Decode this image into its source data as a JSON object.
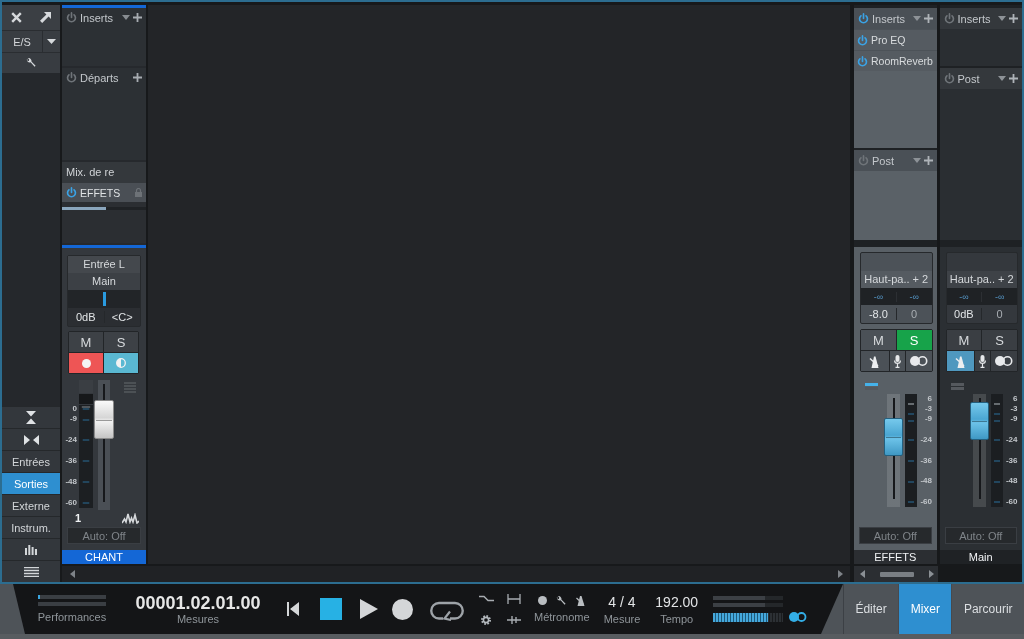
{
  "sidebar": {
    "io_label": "E/S",
    "view_buttons": [
      {
        "label": "Entrées",
        "selected": false
      },
      {
        "label": "Sorties",
        "selected": true
      },
      {
        "label": "Externe",
        "selected": false
      },
      {
        "label": "Instrum.",
        "selected": false
      }
    ]
  },
  "track_channels": [
    {
      "color": "#1467d6",
      "inserts": {
        "label": "Inserts",
        "on": false
      },
      "sends": {
        "label": "Départs",
        "on": false
      },
      "send_group": "Mix. de re",
      "send": {
        "name": "EFFETS",
        "on": true,
        "level": 0.52
      },
      "input": "Entrée L",
      "output": "Main",
      "pan_slider": {
        "level": 0.5
      },
      "volume": "0dB",
      "pan": "<C>",
      "mute": {
        "label": "M",
        "on": false
      },
      "solo": {
        "label": "S",
        "on": false
      },
      "record_armed": true,
      "monitor_on": true,
      "scale": [
        "0",
        "-9",
        "-24",
        "-36",
        "-48",
        "-60"
      ],
      "fader": {
        "level": 0.78
      },
      "number": "1",
      "automation": "Auto: Off",
      "name": "CHANT"
    }
  ],
  "bus_channels": [
    {
      "selected": true,
      "inserts": {
        "label": "Inserts",
        "on": true
      },
      "plugins": [
        {
          "name": "Pro EQ",
          "on": true
        },
        {
          "name": "RoomReverb",
          "on": true
        }
      ],
      "post": {
        "label": "Post",
        "on": false
      },
      "output": "Haut-pa.. + 2",
      "peaks": [
        "-∞",
        "-∞"
      ],
      "volume": "-8.0",
      "pan": "0",
      "mute": {
        "label": "M",
        "on": false
      },
      "solo": {
        "label": "S",
        "on": true
      },
      "tools": [
        {
          "kind": "metronome",
          "on": false
        },
        {
          "kind": "microphone",
          "on": false
        },
        {
          "kind": "toggle",
          "on": false
        }
      ],
      "scale": [
        "6",
        "-3",
        "-9",
        "-24",
        "-36",
        "-48",
        "-60"
      ],
      "fader": {
        "level": 0.68
      },
      "automation": "Auto: Off",
      "name": "EFFETS"
    },
    {
      "selected": false,
      "inserts": {
        "label": "Inserts",
        "on": false
      },
      "post": {
        "label": "Post",
        "on": false
      },
      "output": "Haut-pa.. + 2",
      "peaks": [
        "-∞",
        "-∞"
      ],
      "volume": "0dB",
      "pan": "0",
      "mute": {
        "label": "M",
        "on": false
      },
      "solo": {
        "label": "S",
        "on": false
      },
      "tools": [
        {
          "kind": "metronome",
          "on": true
        },
        {
          "kind": "microphone",
          "on": false
        },
        {
          "kind": "toggle",
          "on": false
        }
      ],
      "scale": [
        "6",
        "-3",
        "-9",
        "-24",
        "-36",
        "-48",
        "-60"
      ],
      "fader": {
        "level": 0.9
      },
      "automation": "Auto: Off",
      "name": "Main"
    }
  ],
  "transport": {
    "performance": {
      "label": "Performances",
      "level": 0.03
    },
    "time": {
      "value": "00001.02.01.00",
      "label": "Mesures"
    },
    "buttons": [
      {
        "kind": "rewind",
        "on": false
      },
      {
        "kind": "stop",
        "on": true
      },
      {
        "kind": "play",
        "on": false
      },
      {
        "kind": "record",
        "on": false
      },
      {
        "kind": "loop",
        "on": false
      }
    ],
    "metronome": {
      "label": "Métronome"
    },
    "signature": {
      "value": "4 / 4",
      "label": "Mesure"
    },
    "tempo": {
      "value": "192.00",
      "label": "Tempo"
    },
    "output_meter": {
      "level": 0.78
    },
    "sync_toggle": {
      "on": true
    }
  },
  "views": [
    {
      "label": "Éditer",
      "selected": false
    },
    {
      "label": "Mixer",
      "selected": true
    },
    {
      "label": "Parcourir",
      "selected": false
    }
  ]
}
